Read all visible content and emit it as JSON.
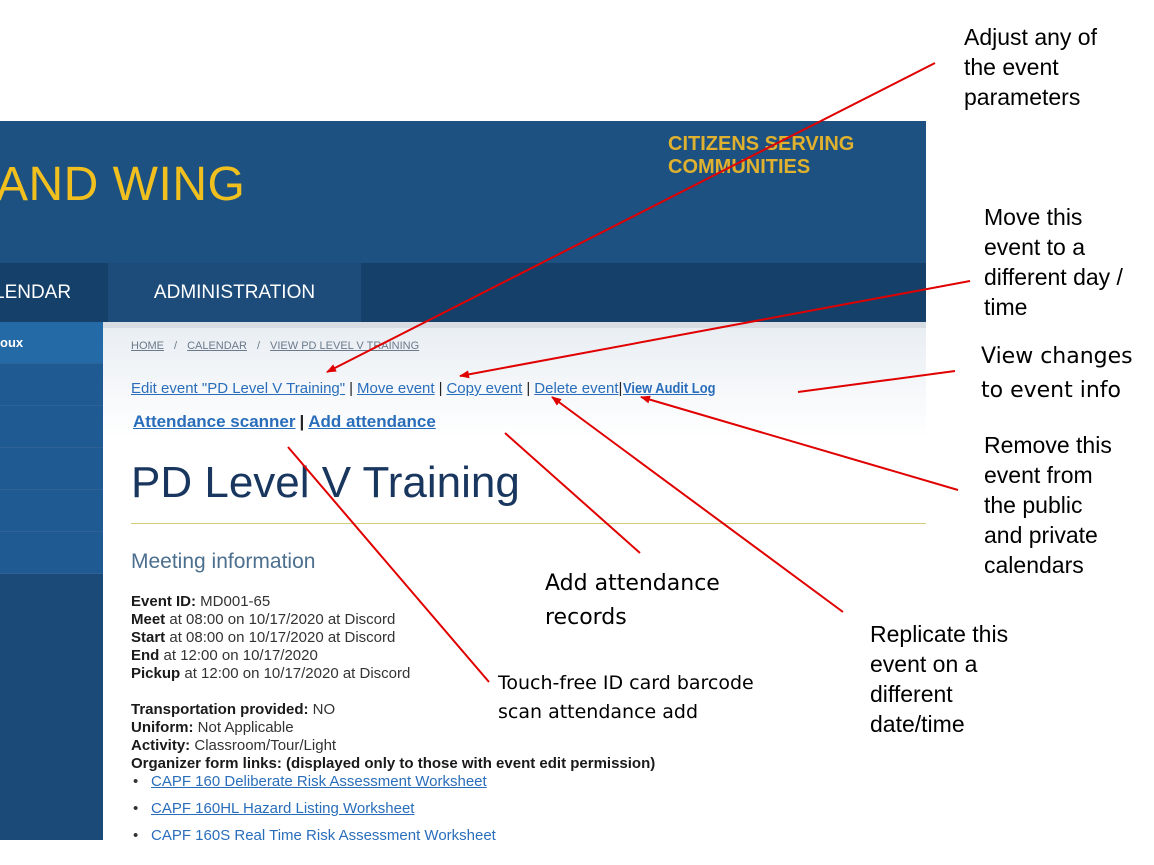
{
  "header": {
    "wing_title": "AND WING",
    "motto": [
      "CITIZENS SERVING",
      "COMMUNITIES"
    ]
  },
  "nav": {
    "calendar": "LENDAR",
    "administration": "ADMINISTRATION"
  },
  "sidebar": {
    "items": [
      {
        "label": "oux"
      },
      {
        "label": ""
      },
      {
        "label": ""
      },
      {
        "label": ""
      },
      {
        "label": ""
      },
      {
        "label": ""
      }
    ]
  },
  "breadcrumb": {
    "home": "HOME",
    "calendar": "CALENDAR",
    "current": "VIEW PD LEVEL V TRAINING",
    "sep": "/"
  },
  "actions": {
    "edit": "Edit event \"PD Level V Training\"",
    "move": "Move event",
    "copy": "Copy event",
    "delete": "Delete event",
    "audit": "View Audit Log",
    "scanner": "Attendance scanner",
    "add_attendance": "Add attendance",
    "sep": "|"
  },
  "page": {
    "title": "PD Level V Training",
    "section": "Meeting information"
  },
  "details": {
    "event_id_label": "Event ID:",
    "event_id": " MD001-65",
    "meet_label": "Meet",
    "meet": " at 08:00 on 10/17/2020 at Discord",
    "start_label": "Start",
    "start": " at 08:00 on 10/17/2020 at Discord",
    "end_label": "End",
    "end": " at 12:00 on 10/17/2020",
    "pickup_label": "Pickup",
    "pickup": " at 12:00 on 10/17/2020 at Discord",
    "transport_label": "Transportation provided:",
    "transport": " NO",
    "uniform_label": "Uniform:",
    "uniform": " Not Applicable",
    "activity_label": "Activity:",
    "activity": " Classroom/Tour/Light",
    "organizer_label": "Organizer form links: (displayed only to those with event edit permission)"
  },
  "form_links": [
    "CAPF 160 Deliberate Risk Assessment Worksheet",
    "CAPF 160HL Hazard Listing Worksheet",
    "CAPF 160S Real Time Risk Assessment Worksheet"
  ],
  "annotations": {
    "adjust": [
      "Adjust any of",
      "the event",
      "parameters"
    ],
    "move": [
      "Move this",
      "event to a",
      "different day /",
      "time"
    ],
    "audit": [
      "View changes",
      "to event info"
    ],
    "remove": [
      "Remove this",
      "event from",
      "the public",
      "and private",
      "calendars"
    ],
    "add": [
      "Add attendance",
      "records"
    ],
    "scanner": [
      "Touch-free ID card barcode",
      "scan attendance add"
    ],
    "replicate": [
      "Replicate this",
      "event on a",
      "different",
      "date/time"
    ]
  },
  "colors": {
    "banner": "#1c5182",
    "accent_gold": "#f2c01e",
    "link": "#2a6ebb",
    "arrow": "#e00000"
  }
}
